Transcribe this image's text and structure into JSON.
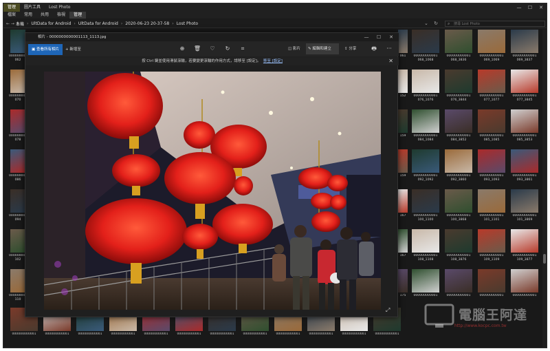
{
  "explorer": {
    "tabs": [
      "管理",
      "圖片工具",
      "Lost Photo"
    ],
    "menu": [
      "檔案",
      "常用",
      "共用",
      "檢視",
      "管理"
    ],
    "nav": "← → ↑",
    "breadcrumbs": [
      "本機",
      "UltData for Android",
      "UltData for Android",
      "2020-06-23 20-37-58",
      "Lost Photo"
    ],
    "addr_buttons": "⌄ ↻",
    "search_placeholder": "搜尋 Lost Photo",
    "window_controls": [
      "—",
      "☐",
      "✕"
    ]
  },
  "grid": {
    "right_cols": [
      {
        "caps": [
          "000000000001 068_1068",
          "000000000001 068_3836",
          "000000000001 069_1069",
          "000000000001 069_3837"
        ]
      },
      {
        "caps": [
          "000000000001 076_1076",
          "000000000001 076_3844",
          "000000000001 077_1077",
          "000000000001 077_3845"
        ]
      },
      {
        "caps": [
          "000000000001 084_1084",
          "000000000001 084_3852",
          "000000000001 085_1085",
          "000000000001 085_3853"
        ]
      },
      {
        "caps": [
          "000000000001 092_1092",
          "000000000001 092_3860",
          "000000000001 093_1093",
          "000000000001 093_3861"
        ]
      },
      {
        "caps": [
          "000000000001 100_1100",
          "000000000001 100_3868",
          "000000000001 101_1101",
          "000000000001 101_3869"
        ]
      },
      {
        "caps": [
          "000000000001 108_1108",
          "000000000001 108_3876",
          "000000000001 109_1109",
          "000000000001 109_3877"
        ]
      },
      {
        "caps": [
          "000000000001",
          "000000000001",
          "000000000001",
          "000000000001"
        ]
      }
    ],
    "left_caps": [
      "000000000001 062",
      "000000000001 070",
      "000000000001 078",
      "000000000001 086",
      "000000000001 094",
      "000000000001 102",
      "000000000001 110"
    ],
    "partial_caps": [
      "062",
      "070",
      "078",
      "086",
      "094",
      "102",
      "110"
    ],
    "mid_caps": [
      "061",
      "152",
      "159",
      "159",
      "167",
      "167",
      "175"
    ],
    "bottom_caps": [
      "000000000001",
      "000000000001",
      "000000000001",
      "000000000001",
      "000000000001",
      "000000000001",
      "000000000001",
      "000000000001",
      "000000000001",
      "000000000001",
      "000000000001",
      "000000000001"
    ]
  },
  "viewer": {
    "title": "相片 - 0000000000001113_1113.jpg",
    "window_controls": [
      "—",
      "☐",
      "✕"
    ],
    "all_photos": "查看所有相片",
    "add_to": "新增至",
    "tools": {
      "zoom": "⊕",
      "delete": "🗑",
      "favorite": "♡",
      "rotate": "↻",
      "crop": "⌗"
    },
    "view_more": "影片",
    "edit_create": "編輯和建立",
    "share": "分享",
    "print": "🖶",
    "more": "···",
    "tip": "按 Ctrl 鍵並使用滑鼠滾輪，若要變更滾輪的作用方式，請移至 [設定]。",
    "tip_link": "移至 [設定]",
    "tip_close": "✕",
    "expand": "⤢"
  },
  "watermark": {
    "text": "電腦王阿達",
    "url": "http://www.kocpc.com.tw"
  },
  "colors": {
    "accent": "#1e66b8",
    "lantern": "#e0201a",
    "background": "#191919"
  }
}
